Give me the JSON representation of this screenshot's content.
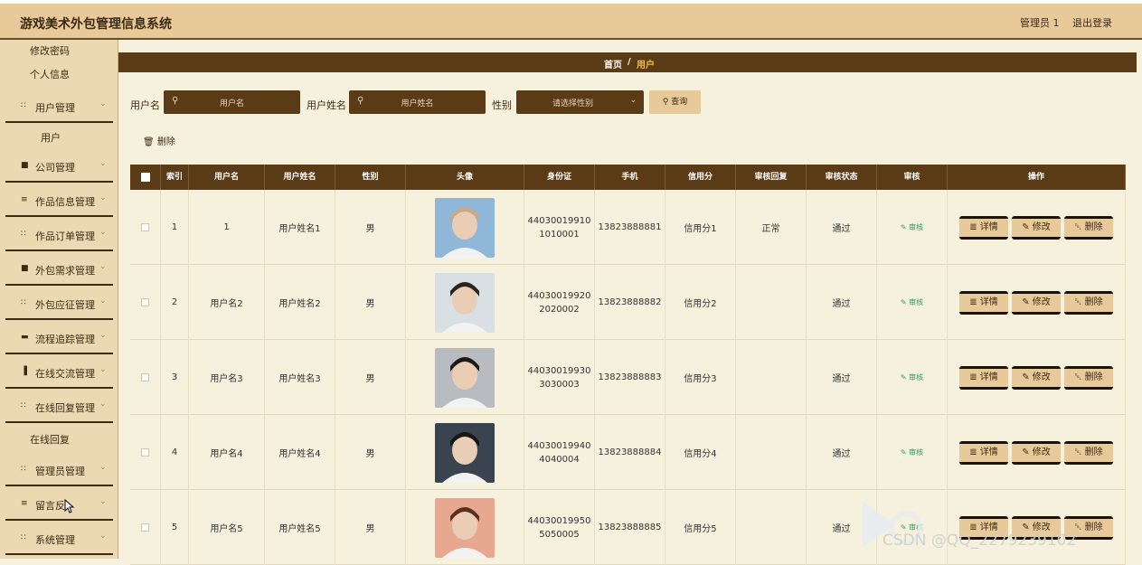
{
  "header": {
    "title": "游戏美术外包管理信息系统",
    "admin": "管理员 1",
    "logout": "退出登录"
  },
  "sidebar": {
    "items": [
      {
        "type": "sub",
        "label": "修改密码"
      },
      {
        "type": "sub",
        "label": "个人信息"
      },
      {
        "type": "menu",
        "label": "用户管理",
        "icon": "grid-icon"
      },
      {
        "type": "sub",
        "label": "用户"
      },
      {
        "type": "menu",
        "label": "公司管理",
        "icon": "cup-icon"
      },
      {
        "type": "menu",
        "label": "作品信息管理",
        "icon": "list-icon"
      },
      {
        "type": "menu",
        "label": "作品订单管理",
        "icon": "grid-icon"
      },
      {
        "type": "menu",
        "label": "外包需求管理",
        "icon": "cup-icon"
      },
      {
        "type": "menu",
        "label": "外包应征管理",
        "icon": "grid-icon"
      },
      {
        "type": "menu",
        "label": "流程追踪管理",
        "icon": "monitor-icon"
      },
      {
        "type": "menu",
        "label": "在线交流管理",
        "icon": "bar-chart-icon"
      },
      {
        "type": "menu",
        "label": "在线回复管理",
        "icon": "grid-icon"
      },
      {
        "type": "sub",
        "label": "在线回复"
      },
      {
        "type": "menu",
        "label": "管理员管理",
        "icon": "grid-icon"
      },
      {
        "type": "menu",
        "label": "留言反",
        "icon": "list-icon"
      },
      {
        "type": "menu",
        "label": "系统管理",
        "icon": "grid-icon"
      }
    ]
  },
  "breadcrumb": {
    "home": "首页",
    "sep": "/",
    "current": "用户"
  },
  "filters": {
    "username_label": "用户名",
    "username_placeholder": "用户名",
    "realname_label": "用户姓名",
    "realname_placeholder": "用户姓名",
    "gender_label": "性别",
    "gender_placeholder": "请选择性别",
    "query": "查询"
  },
  "toolbar": {
    "delete": "删除"
  },
  "table": {
    "headers": [
      "",
      "索引",
      "用户名",
      "用户姓名",
      "性别",
      "头像",
      "身份证",
      "手机",
      "信用分",
      "审核回复",
      "审核状态",
      "审核",
      "操作"
    ],
    "audit_label": "审核",
    "ops": [
      "详情",
      "修改",
      "删除"
    ],
    "rows": [
      {
        "index": "1",
        "username": "1",
        "realname": "用户姓名1",
        "gender": "男",
        "id1": "44030019910",
        "id2": "1010001",
        "phone": "13823888881",
        "credit": "信用分1",
        "reply": "正常",
        "status": "通过",
        "avatar_color": "#c9a98a",
        "avatar_bg": "#8fb8d8"
      },
      {
        "index": "2",
        "username": "用户名2",
        "realname": "用户姓名2",
        "gender": "男",
        "id1": "44030019920",
        "id2": "2020002",
        "phone": "13823888882",
        "credit": "信用分2",
        "reply": "",
        "status": "通过",
        "avatar_color": "#2a2420",
        "avatar_bg": "#d8e0e4"
      },
      {
        "index": "3",
        "username": "用户名3",
        "realname": "用户姓名3",
        "gender": "男",
        "id1": "44030019930",
        "id2": "3030003",
        "phone": "13823888883",
        "credit": "信用分3",
        "reply": "",
        "status": "通过",
        "avatar_color": "#1e1a18",
        "avatar_bg": "#b8bcc0"
      },
      {
        "index": "4",
        "username": "用户名4",
        "realname": "用户姓名4",
        "gender": "男",
        "id1": "44030019940",
        "id2": "4040004",
        "phone": "13823888884",
        "credit": "信用分4",
        "reply": "",
        "status": "通过",
        "avatar_color": "#1a1614",
        "avatar_bg": "#3a4450"
      },
      {
        "index": "5",
        "username": "用户名5",
        "realname": "用户姓名5",
        "gender": "男",
        "id1": "44030019950",
        "id2": "5050005",
        "phone": "13823888885",
        "credit": "信用分5",
        "reply": "",
        "status": "通过",
        "avatar_color": "#5a3020",
        "avatar_bg": "#e8a890"
      }
    ]
  },
  "watermark": "CSDN @QQ_2279239102"
}
